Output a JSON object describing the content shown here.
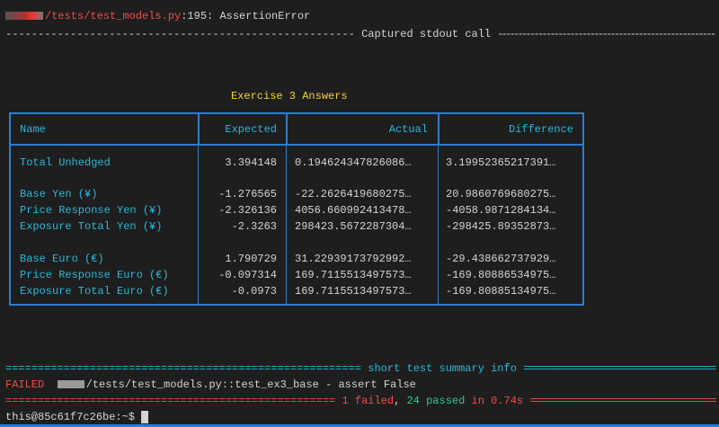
{
  "error_line": {
    "path": "tests/test_models.py",
    "rest": ":195: AssertionError"
  },
  "captured_line": "------------------------------------------------------ Captured stdout call ------------------------------------------------------",
  "table": {
    "title": "Exercise 3 Answers",
    "headers": [
      "Name",
      "Expected",
      "Actual",
      "Difference"
    ],
    "rows": [
      {
        "name": "Total Unhedged",
        "expected": "3.394148",
        "actual": "0.194624347826086…",
        "difference": "3.19952365217391…"
      },
      {
        "name": "Base Yen (¥)",
        "expected": "-1.276565",
        "actual": "-22.2626419680275…",
        "difference": "20.9860769680275…"
      },
      {
        "name": "Price Response Yen (¥)",
        "expected": "-2.326136",
        "actual": "4056.660992413478…",
        "difference": "-4058.9871284134…"
      },
      {
        "name": "Exposure Total Yen (¥)",
        "expected": "-2.3263",
        "actual": "298423.5672287304…",
        "difference": "-298425.89352873…"
      },
      {
        "name": "Base Euro (€)",
        "expected": "1.790729",
        "actual": "31.22939173792992…",
        "difference": "-29.438662737929…"
      },
      {
        "name": "Price Response Euro (€)",
        "expected": "-0.097314",
        "actual": "169.7115513497573…",
        "difference": "-169.80886534975…"
      },
      {
        "name": "Exposure Total Euro (€)",
        "expected": "-0.0973",
        "actual": "169.7115513497573…",
        "difference": "-169.80885134975…"
      }
    ]
  },
  "summary": {
    "header_left": "=======================================================",
    "header_text": " short test summary info ",
    "header_right": "=======================================================",
    "failed_label": "FAILED",
    "failed_path": "/tests/test_models.py::test_ex3_base - assert False",
    "result_left": "=================================================== ",
    "failed_count": "1 failed",
    "comma": ", ",
    "passed_count": "24 passed",
    "time": " in 0.74s ",
    "result_right": "=================================================="
  },
  "prompt": "this@85c61f7c26be:~$ "
}
